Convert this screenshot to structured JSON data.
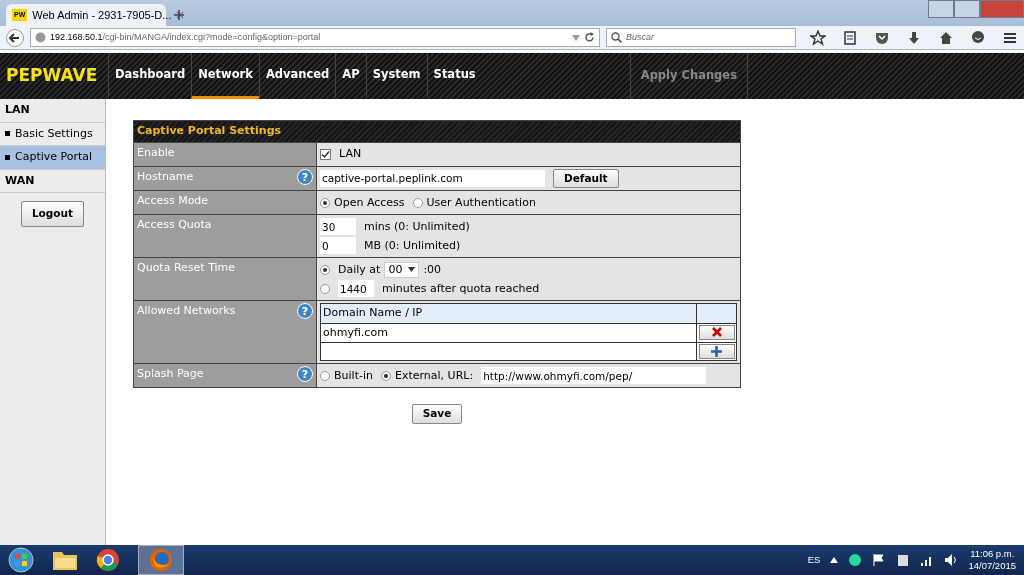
{
  "browser": {
    "tab_title": "Web Admin - 2931-7905-D...",
    "favicon": "PW",
    "address_host": "192.168.50.1",
    "address_path": "/cgi-bin/MANGA/index.cgi?mode=config&option=portal",
    "search_placeholder": "Buscar"
  },
  "app": {
    "logo": "PEPWAVE",
    "nav": [
      {
        "label": "Dashboard",
        "selected": false
      },
      {
        "label": "Network",
        "selected": true
      },
      {
        "label": "Advanced",
        "selected": false
      },
      {
        "label": "AP",
        "selected": false
      },
      {
        "label": "System",
        "selected": false
      },
      {
        "label": "Status",
        "selected": false
      }
    ],
    "apply": {
      "label": "Apply Changes",
      "disabled": true
    }
  },
  "sidebar": {
    "items": [
      {
        "kind": "heading",
        "label": "LAN",
        "selected": false
      },
      {
        "kind": "link",
        "label": "Basic Settings",
        "selected": false
      },
      {
        "kind": "link",
        "label": "Captive Portal",
        "selected": true
      },
      {
        "kind": "heading",
        "label": "WAN",
        "selected": false
      }
    ],
    "logout": "Logout"
  },
  "form": {
    "title": "Captive Portal Settings",
    "rows": [
      {
        "kind": "checkbox",
        "label": "Enable",
        "option": "LAN",
        "checked": true
      },
      {
        "kind": "text",
        "label": "Hostname",
        "help": "?",
        "value": "captive-portal.peplink.com",
        "button": "Default"
      },
      {
        "kind": "radios",
        "label": "Access Mode",
        "options": [
          {
            "label": "Open Access",
            "selected": true
          },
          {
            "label": "User Authentication",
            "selected": false
          }
        ]
      },
      {
        "kind": "inputs",
        "label": "Access Quota",
        "lines": [
          {
            "value": "30",
            "unit": "mins (0: Unlimited)"
          },
          {
            "value": "0",
            "unit": "MB (0: Unlimited)"
          }
        ]
      },
      {
        "kind": "reset",
        "label": "Quota Reset Time",
        "daily": {
          "selected": true,
          "label": "Daily at",
          "hour": "00",
          "suffix": ":00"
        },
        "after": {
          "selected": false,
          "value": "1440",
          "suffix": "minutes after quota reached"
        }
      },
      {
        "kind": "list",
        "label": "Allowed Networks",
        "help": "?",
        "header": "Domain Name / IP",
        "entries": [
          "ohmyfi.com"
        ]
      },
      {
        "kind": "splash",
        "label": "Splash Page",
        "help": "?",
        "options": [
          {
            "label": "Built-in",
            "selected": false
          },
          {
            "label": "External, URL:",
            "selected": true
          }
        ],
        "url": "http://www.ohmyfi.com/pep/"
      }
    ],
    "save": "Save"
  },
  "taskbar": {
    "language": "ES",
    "time": "11:06 p.m.",
    "date": "14/07/2015"
  }
}
